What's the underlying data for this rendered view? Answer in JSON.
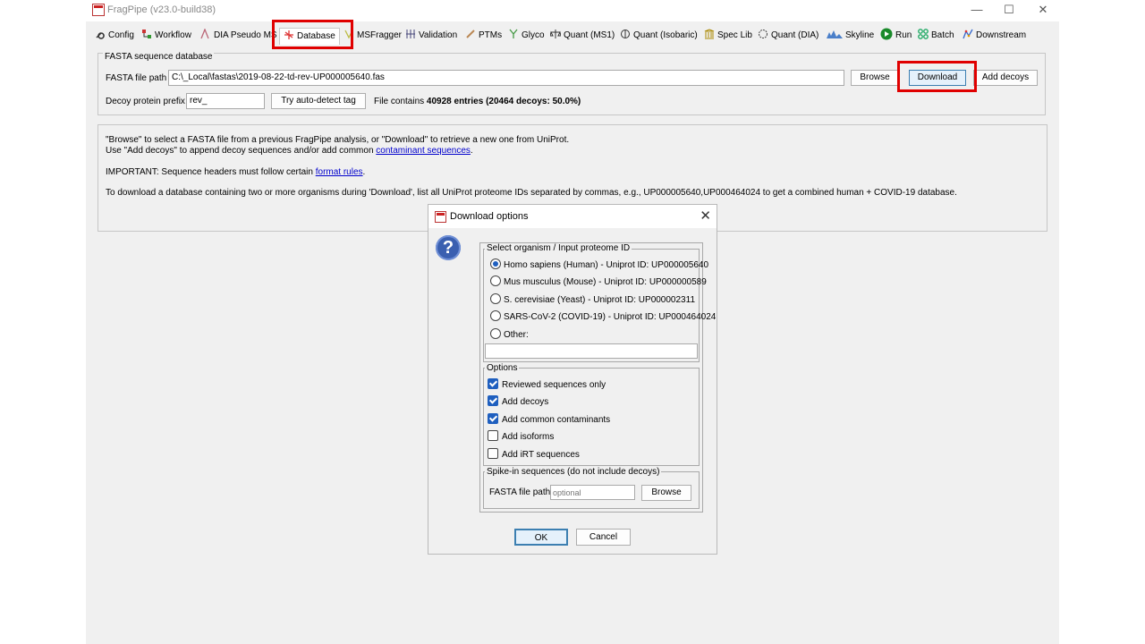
{
  "window": {
    "title": "FragPipe (v23.0-build38)",
    "minimize": "—",
    "maximize": "☐",
    "close": "✕"
  },
  "tabs": [
    {
      "label": "Config",
      "icon": "wrench-icon"
    },
    {
      "label": "Workflow",
      "icon": "workflow-icon"
    },
    {
      "label": "DIA Pseudo MS",
      "icon": "peak-icon"
    },
    {
      "label": "Database",
      "icon": "database-icon"
    },
    {
      "label": "MSFragger",
      "icon": "fragger-icon"
    },
    {
      "label": "Validation",
      "icon": "validation-icon"
    },
    {
      "label": "PTMs",
      "icon": "pencil-icon"
    },
    {
      "label": "Glyco",
      "icon": "glyco-icon"
    },
    {
      "label": "Quant (MS1)",
      "icon": "scale-icon"
    },
    {
      "label": "Quant (Isobaric)",
      "icon": "scale-icon"
    },
    {
      "label": "Spec Lib",
      "icon": "library-icon"
    },
    {
      "label": "Quant (DIA)",
      "icon": "dia-icon"
    },
    {
      "label": "Skyline",
      "icon": "skyline-icon"
    },
    {
      "label": "Run",
      "icon": "play-icon"
    },
    {
      "label": "Batch",
      "icon": "batch-icon"
    },
    {
      "label": "Downstream",
      "icon": "downstream-icon"
    }
  ],
  "database": {
    "section_title": "FASTA sequence database",
    "fasta_label": "FASTA file path",
    "fasta_value": "C:\\_Local\\fastas\\2019-08-22-td-rev-UP000005640.fas",
    "browse": "Browse",
    "download": "Download",
    "add_decoys": "Add decoys",
    "decoy_label": "Decoy protein prefix",
    "decoy_value": "rev_",
    "autodetect": "Try auto-detect tag",
    "contains_prefix": "File contains ",
    "contains_bold": "40928 entries (20464 decoys: 50.0%)"
  },
  "info": {
    "line1": "\"Browse\" to select a FASTA file from a previous FragPipe analysis, or \"Download\" to retrieve a new one from UniProt.",
    "line2_prefix": "Use \"Add decoys\" to append decoy sequences and/or add common ",
    "line2_link": "contaminant sequences",
    "line2_suffix": ".",
    "line3_prefix": "IMPORTANT: Sequence headers must follow certain ",
    "line3_link": "format rules",
    "line3_suffix": ".",
    "line4": "To download a database containing two or more organisms during 'Download', list all UniProt proteome IDs separated by commas, e.g., UP000005640,UP000464024 to get a combined human + COVID-19 database."
  },
  "dialog": {
    "title": "Download options",
    "close": "✕",
    "help_icon": "?",
    "organism_title": "Select organism / Input proteome ID",
    "organisms": [
      {
        "label": "Homo sapiens (Human) - Uniprot ID: UP000005640",
        "selected": true
      },
      {
        "label": "Mus musculus (Mouse) - Uniprot ID: UP000000589",
        "selected": false
      },
      {
        "label": "S. cerevisiae (Yeast) - Uniprot ID: UP000002311",
        "selected": false
      },
      {
        "label": "SARS-CoV-2 (COVID-19) - Uniprot ID: UP000464024",
        "selected": false
      },
      {
        "label": "Other:",
        "selected": false
      }
    ],
    "other_value": "",
    "options_title": "Options",
    "options": [
      {
        "label": "Reviewed sequences only",
        "checked": true
      },
      {
        "label": "Add decoys",
        "checked": true
      },
      {
        "label": "Add common contaminants",
        "checked": true
      },
      {
        "label": "Add isoforms",
        "checked": false
      },
      {
        "label": "Add iRT sequences",
        "checked": false
      }
    ],
    "spikein_title": "Spike-in sequences (do not include decoys)",
    "spikein_label": "FASTA file path",
    "spikein_placeholder": "optional",
    "spikein_browse": "Browse",
    "ok": "OK",
    "cancel": "Cancel"
  },
  "colors": {
    "highlight": "#e00000",
    "link": "#0000cc",
    "accent": "#1f5fbf"
  }
}
